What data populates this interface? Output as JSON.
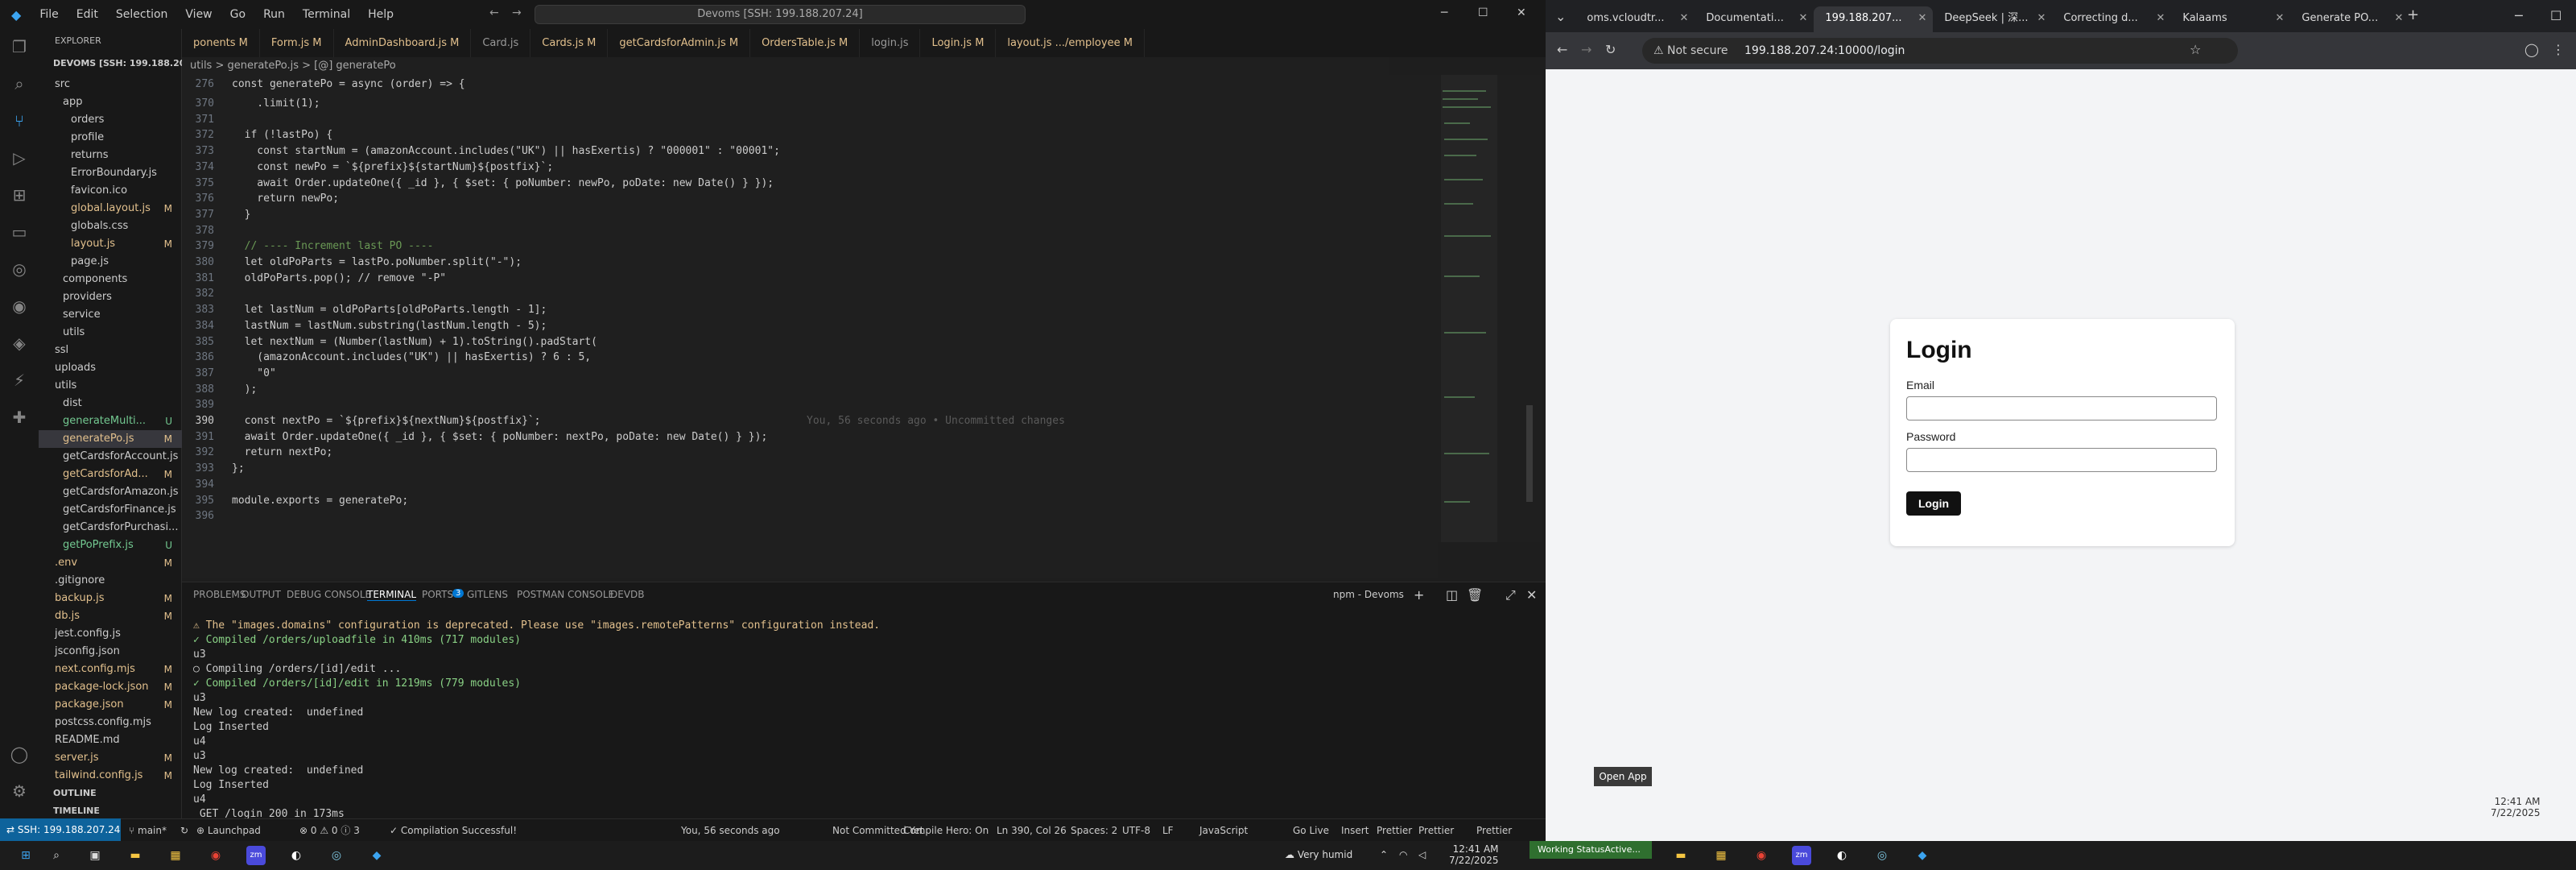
{
  "vscode": {
    "menu": [
      "File",
      "Edit",
      "Selection",
      "View",
      "Go",
      "Run",
      "Terminal",
      "Help"
    ],
    "command_center": "Devoms [SSH: 199.188.207.24]",
    "sidebar": {
      "title": "EXPLORER",
      "root": "DEVOMS [SSH: 199.188.20...",
      "items": [
        {
          "name": "src",
          "indent": 1,
          "badge": ""
        },
        {
          "name": "app",
          "indent": 2,
          "badge": ""
        },
        {
          "name": "orders",
          "indent": 3,
          "badge": ""
        },
        {
          "name": "profile",
          "indent": 3,
          "badge": ""
        },
        {
          "name": "returns",
          "indent": 3,
          "badge": ""
        },
        {
          "name": "ErrorBoundary.js",
          "indent": 3,
          "badge": ""
        },
        {
          "name": "favicon.ico",
          "indent": 3,
          "badge": ""
        },
        {
          "name": "global.layout.js",
          "indent": 3,
          "badge": "M"
        },
        {
          "name": "globals.css",
          "indent": 3,
          "badge": ""
        },
        {
          "name": "layout.js",
          "indent": 3,
          "badge": "M"
        },
        {
          "name": "page.js",
          "indent": 3,
          "badge": ""
        },
        {
          "name": "components",
          "indent": 2,
          "badge": ""
        },
        {
          "name": "providers",
          "indent": 2,
          "badge": ""
        },
        {
          "name": "service",
          "indent": 2,
          "badge": ""
        },
        {
          "name": "utils",
          "indent": 2,
          "badge": ""
        },
        {
          "name": "ssl",
          "indent": 1,
          "badge": ""
        },
        {
          "name": "uploads",
          "indent": 1,
          "badge": ""
        },
        {
          "name": "utils",
          "indent": 1,
          "badge": ""
        },
        {
          "name": "dist",
          "indent": 2,
          "badge": ""
        },
        {
          "name": "generateMulti...",
          "indent": 2,
          "badge": "U"
        },
        {
          "name": "generatePo.js",
          "indent": 2,
          "badge": "M"
        },
        {
          "name": "getCardsforAccount.js",
          "indent": 2,
          "badge": ""
        },
        {
          "name": "getCardsforAd...",
          "indent": 2,
          "badge": "M"
        },
        {
          "name": "getCardsforAmazon.js",
          "indent": 2,
          "badge": ""
        },
        {
          "name": "getCardsforFinance.js",
          "indent": 2,
          "badge": ""
        },
        {
          "name": "getCardsforPurchasi...",
          "indent": 2,
          "badge": ""
        },
        {
          "name": "getPoPrefix.js",
          "indent": 2,
          "badge": "U"
        },
        {
          "name": ".env",
          "indent": 1,
          "badge": "M"
        },
        {
          "name": ".gitignore",
          "indent": 1,
          "badge": ""
        },
        {
          "name": "backup.js",
          "indent": 1,
          "badge": "M"
        },
        {
          "name": "db.js",
          "indent": 1,
          "badge": "M"
        },
        {
          "name": "jest.config.js",
          "indent": 1,
          "badge": ""
        },
        {
          "name": "jsconfig.json",
          "indent": 1,
          "badge": ""
        },
        {
          "name": "next.config.mjs",
          "indent": 1,
          "badge": "M"
        },
        {
          "name": "package-lock.json",
          "indent": 1,
          "badge": "M"
        },
        {
          "name": "package.json",
          "indent": 1,
          "badge": "M"
        },
        {
          "name": "postcss.config.mjs",
          "indent": 1,
          "badge": ""
        },
        {
          "name": "README.md",
          "indent": 1,
          "badge": ""
        },
        {
          "name": "server.js",
          "indent": 1,
          "badge": "M"
        },
        {
          "name": "tailwind.config.js",
          "indent": 1,
          "badge": "M"
        }
      ],
      "outline": "OUTLINE",
      "timeline": "TIMELINE"
    },
    "tabs": [
      {
        "label": "ponents M",
        "active": false
      },
      {
        "label": "Form.js M",
        "active": false
      },
      {
        "label": "AdminDashboard.js M",
        "active": false
      },
      {
        "label": "Card.js",
        "active": false
      },
      {
        "label": "Cards.js M",
        "active": false
      },
      {
        "label": "getCardsforAdmin.js M",
        "active": false
      },
      {
        "label": "OrdersTable.js M",
        "active": false
      },
      {
        "label": "login.js",
        "active": false
      },
      {
        "label": "Login.js M",
        "active": false
      },
      {
        "label": "layout.js .../employee M",
        "active": false
      }
    ],
    "breadcrumb": "utils > generatePo.js > [@] generatePo",
    "sticky": {
      "num": "276",
      "text": "const generatePo = async (order) => {"
    },
    "code": [
      {
        "n": "370",
        "t": "    .limit(1);"
      },
      {
        "n": "371",
        "t": ""
      },
      {
        "n": "372",
        "t": "  if (!lastPo) {"
      },
      {
        "n": "373",
        "t": "    const startNum = (amazonAccount.includes(\"UK\") || hasExertis) ? \"000001\" : \"00001\";"
      },
      {
        "n": "374",
        "t": "    const newPo = `${prefix}${startNum}${postfix}`;"
      },
      {
        "n": "375",
        "t": "    await Order.updateOne({ _id }, { $set: { poNumber: newPo, poDate: new Date() } });"
      },
      {
        "n": "376",
        "t": "    return newPo;"
      },
      {
        "n": "377",
        "t": "  }"
      },
      {
        "n": "378",
        "t": ""
      },
      {
        "n": "379",
        "t": "  // ---- Increment last PO ----"
      },
      {
        "n": "380",
        "t": "  let oldPoParts = lastPo.poNumber.split(\"-\");"
      },
      {
        "n": "381",
        "t": "  oldPoParts.pop(); // remove \"-P\""
      },
      {
        "n": "382",
        "t": ""
      },
      {
        "n": "383",
        "t": "  let lastNum = oldPoParts[oldPoParts.length - 1];"
      },
      {
        "n": "384",
        "t": "  lastNum = lastNum.substring(lastNum.length - 5);"
      },
      {
        "n": "385",
        "t": "  let nextNum = (Number(lastNum) + 1).toString().padStart("
      },
      {
        "n": "386",
        "t": "    (amazonAccount.includes(\"UK\") || hasExertis) ? 6 : 5,"
      },
      {
        "n": "387",
        "t": "    \"0\""
      },
      {
        "n": "388",
        "t": "  );"
      },
      {
        "n": "389",
        "t": ""
      },
      {
        "n": "390",
        "t": "  const nextPo = `${prefix}${nextNum}${postfix}`;"
      },
      {
        "n": "391",
        "t": "  await Order.updateOne({ _id }, { $set: { poNumber: nextPo, poDate: new Date() } });"
      },
      {
        "n": "392",
        "t": "  return nextPo;"
      },
      {
        "n": "393",
        "t": "};"
      },
      {
        "n": "394",
        "t": ""
      },
      {
        "n": "395",
        "t": "module.exports = generatePo;"
      },
      {
        "n": "396",
        "t": ""
      }
    ],
    "blame": "You, 56 seconds ago • Uncommitted changes",
    "panel": {
      "tabs": [
        "PROBLEMS",
        "OUTPUT",
        "DEBUG CONSOLE",
        "TERMINAL",
        "PORTS",
        "GITLENS",
        "POSTMAN CONSOLE",
        "DEVDB"
      ],
      "ports_count": "3",
      "terminal_name": "npm - Devoms",
      "lines": [
        "⚠ The \"images.domains\" configuration is deprecated. Please use \"images.remotePatterns\" configuration instead.",
        "✓ Compiled /orders/uploadfile in 410ms (717 modules)",
        "u3",
        "○ Compiling /orders/[id]/edit ...",
        "✓ Compiled /orders/[id]/edit in 1219ms (779 modules)",
        "u3",
        "New log created:  undefined",
        "Log Inserted",
        "u4",
        "u3",
        "New log created:  undefined",
        "Log Inserted",
        "u4",
        " GET /login 200 in 173ms"
      ]
    },
    "status": {
      "remote": "SSH: 199.188.207.24",
      "branch": "main*",
      "errors": "0",
      "warnings": "0",
      "info": "3",
      "launchpad": "Launchpad",
      "compile": "Compilation Successful!",
      "blame": "You, 56 seconds ago",
      "commit": "Not Committed Yet",
      "compile_hero": "Compile Hero: On",
      "position": "Ln 390, Col 26",
      "spaces": "Spaces: 2",
      "encoding": "UTF-8",
      "eol": "LF",
      "language": "JavaScript",
      "golive": "Go Live",
      "insert": "Insert",
      "prettier1": "Prettier",
      "prettier2": "Prettier",
      "prettier3": "Prettier"
    }
  },
  "chrome": {
    "tabs": [
      {
        "label": "oms.vcloudtr...",
        "active": false
      },
      {
        "label": "Documentati...",
        "active": false
      },
      {
        "label": "199.188.207...",
        "active": true
      },
      {
        "label": "DeepSeek | 深...",
        "active": false
      },
      {
        "label": "Correcting d...",
        "active": false
      },
      {
        "label": "Kalaams",
        "active": false
      },
      {
        "label": "Generate PO...",
        "active": false
      }
    ],
    "security": "Not secure",
    "url": "199.188.207.24:10000/login",
    "login": {
      "title": "Login",
      "email_label": "Email",
      "password_label": "Password",
      "button": "Login"
    },
    "open_app": "Open App"
  },
  "taskbar": {
    "weather": "Very humid",
    "time": "12:41 AM",
    "date": "7/22/2025",
    "time2": "12:41 AM",
    "date2": "7/22/2025",
    "working": "Working StatusActive..."
  }
}
